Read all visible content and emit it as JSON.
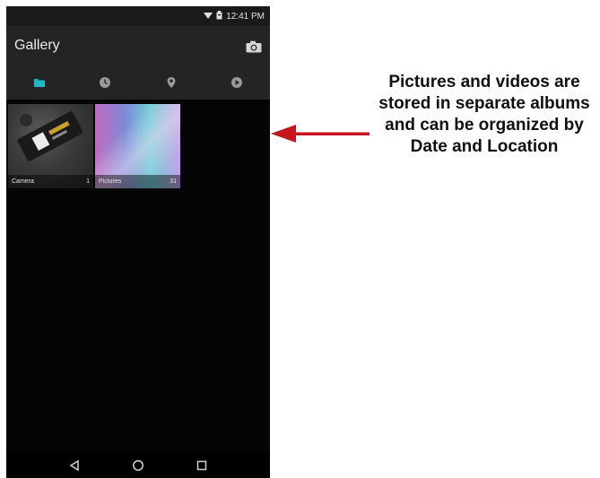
{
  "status_bar": {
    "time": "12:41 PM",
    "icons": [
      "wifi-icon",
      "battery-icon"
    ]
  },
  "app_bar": {
    "title": "Gallery",
    "action_icon": "camera-icon"
  },
  "tabs": [
    {
      "icon": "album-folder-icon",
      "selected": true
    },
    {
      "icon": "clock-icon",
      "selected": false
    },
    {
      "icon": "location-pin-icon",
      "selected": false
    },
    {
      "icon": "play-video-icon",
      "selected": false
    }
  ],
  "albums": [
    {
      "name": "Camera",
      "count": "1"
    },
    {
      "name": "Pictures",
      "count": "31"
    }
  ],
  "nav_bar": {
    "icons": [
      "back-icon",
      "home-icon",
      "recents-icon"
    ]
  },
  "annotation": {
    "text": "Pictures and videos are stored in separate albums and can be organized by Date and Location"
  },
  "colors": {
    "accent": "#21b7c8",
    "inactive_tab_icon": "#9a9a9a",
    "arrow": "#c4161c"
  }
}
